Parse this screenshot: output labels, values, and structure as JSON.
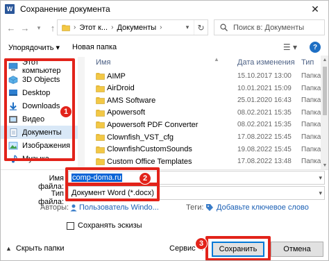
{
  "window": {
    "title": "Сохранение документа",
    "app_icon": "W"
  },
  "nav": {
    "breadcrumbs": [
      "Этот к...",
      "Документы"
    ],
    "search_placeholder": "Поиск в: Документы"
  },
  "toolbar": {
    "organize": "Упорядочить ▾",
    "new_folder": "Новая папка"
  },
  "sidebar": {
    "items": [
      {
        "label": "Этот компьютер",
        "icon": "computer-icon"
      },
      {
        "label": "3D Objects",
        "icon": "cube-icon"
      },
      {
        "label": "Desktop",
        "icon": "desktop-icon"
      },
      {
        "label": "Downloads",
        "icon": "download-icon"
      },
      {
        "label": "Видео",
        "icon": "video-icon"
      },
      {
        "label": "Документы",
        "icon": "documents-icon"
      },
      {
        "label": "Изображения",
        "icon": "images-icon"
      },
      {
        "label": "Музыка",
        "icon": "music-icon"
      }
    ],
    "selected_index": 5
  },
  "filelist": {
    "columns": {
      "name": "Имя",
      "date": "Дата изменения",
      "type": "Тип"
    },
    "rows": [
      {
        "name": "AIMP",
        "date": "15.10.2017 13:00",
        "type": "Папка"
      },
      {
        "name": "AirDroid",
        "date": "10.01.2021 15:09",
        "type": "Папка"
      },
      {
        "name": "AMS Software",
        "date": "25.01.2020 16:43",
        "type": "Папка"
      },
      {
        "name": "Apowersoft",
        "date": "08.02.2021 15:35",
        "type": "Папка"
      },
      {
        "name": "Apowersoft PDF Converter",
        "date": "08.02.2021 15:35",
        "type": "Папка"
      },
      {
        "name": "Clownfish_VST_cfg",
        "date": "17.08.2022 15:45",
        "type": "Папка"
      },
      {
        "name": "ClownfishCustomSounds",
        "date": "19.08.2022 15:45",
        "type": "Папка"
      },
      {
        "name": "Custom Office Templates",
        "date": "17.08.2022 13:48",
        "type": "Папка"
      }
    ]
  },
  "form": {
    "filename_label": "Имя файла:",
    "filename_value": "comp-doma.ru",
    "filetype_label": "Тип файла:",
    "filetype_value": "Документ Word (*.docx)",
    "authors_label": "Авторы:",
    "authors_value": "Пользователь Windo...",
    "tags_label": "Теги:",
    "tags_value": "Добавьте ключевое слово",
    "thumbnail_checkbox_label": "Сохранять эскизы"
  },
  "footer": {
    "hide_folders": "Скрыть папки",
    "service": "Сервис",
    "save": "Сохранить",
    "cancel": "Отмена"
  },
  "badges": [
    "1",
    "2",
    "3"
  ],
  "colors": {
    "annotation_red": "#e2231a",
    "folder_yellow": "#f3c845",
    "link_blue": "#1a5fb4",
    "selection_blue": "#0a64d6"
  }
}
